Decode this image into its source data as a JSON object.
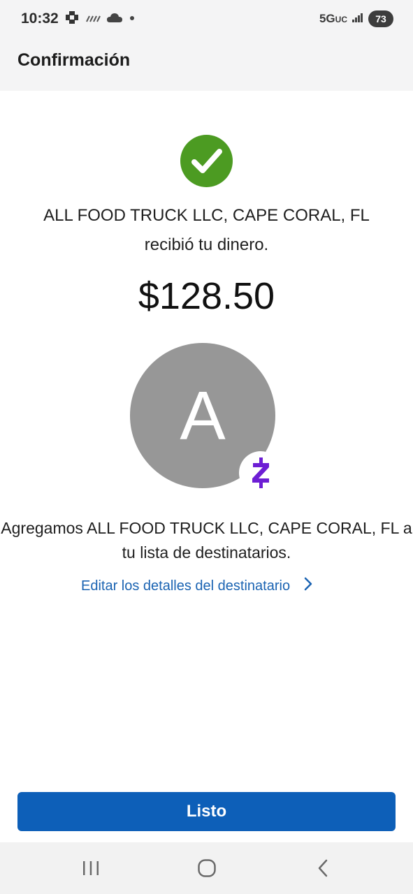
{
  "status_bar": {
    "time": "10:32",
    "network": "5G",
    "network_suffix": "UC",
    "battery": "73",
    "icons": [
      "chase-icon",
      "signal-bars-icon",
      "cloud-icon",
      "dot-icon",
      "cell-signal-icon"
    ]
  },
  "header": {
    "title": "Confirmación"
  },
  "confirmation": {
    "recipient_line1": "ALL FOOD TRUCK LLC, CAPE CORAL, FL",
    "recipient_line2": "recibió tu dinero.",
    "amount": "$128.50",
    "avatar_letter": "A",
    "added_line1": "Agregamos ALL FOOD TRUCK LLC, CAPE CORAL, FL a",
    "added_line2": "tu lista de destinatarios.",
    "edit_link": "Editar los detalles del destinatario",
    "success_color": "#4c9b22",
    "zelle_color": "#6d1ed4"
  },
  "actions": {
    "done_label": "Listo",
    "primary_color": "#0d5fb8"
  },
  "navigation": {
    "buttons": [
      "recents-icon",
      "home-icon",
      "back-icon"
    ]
  }
}
